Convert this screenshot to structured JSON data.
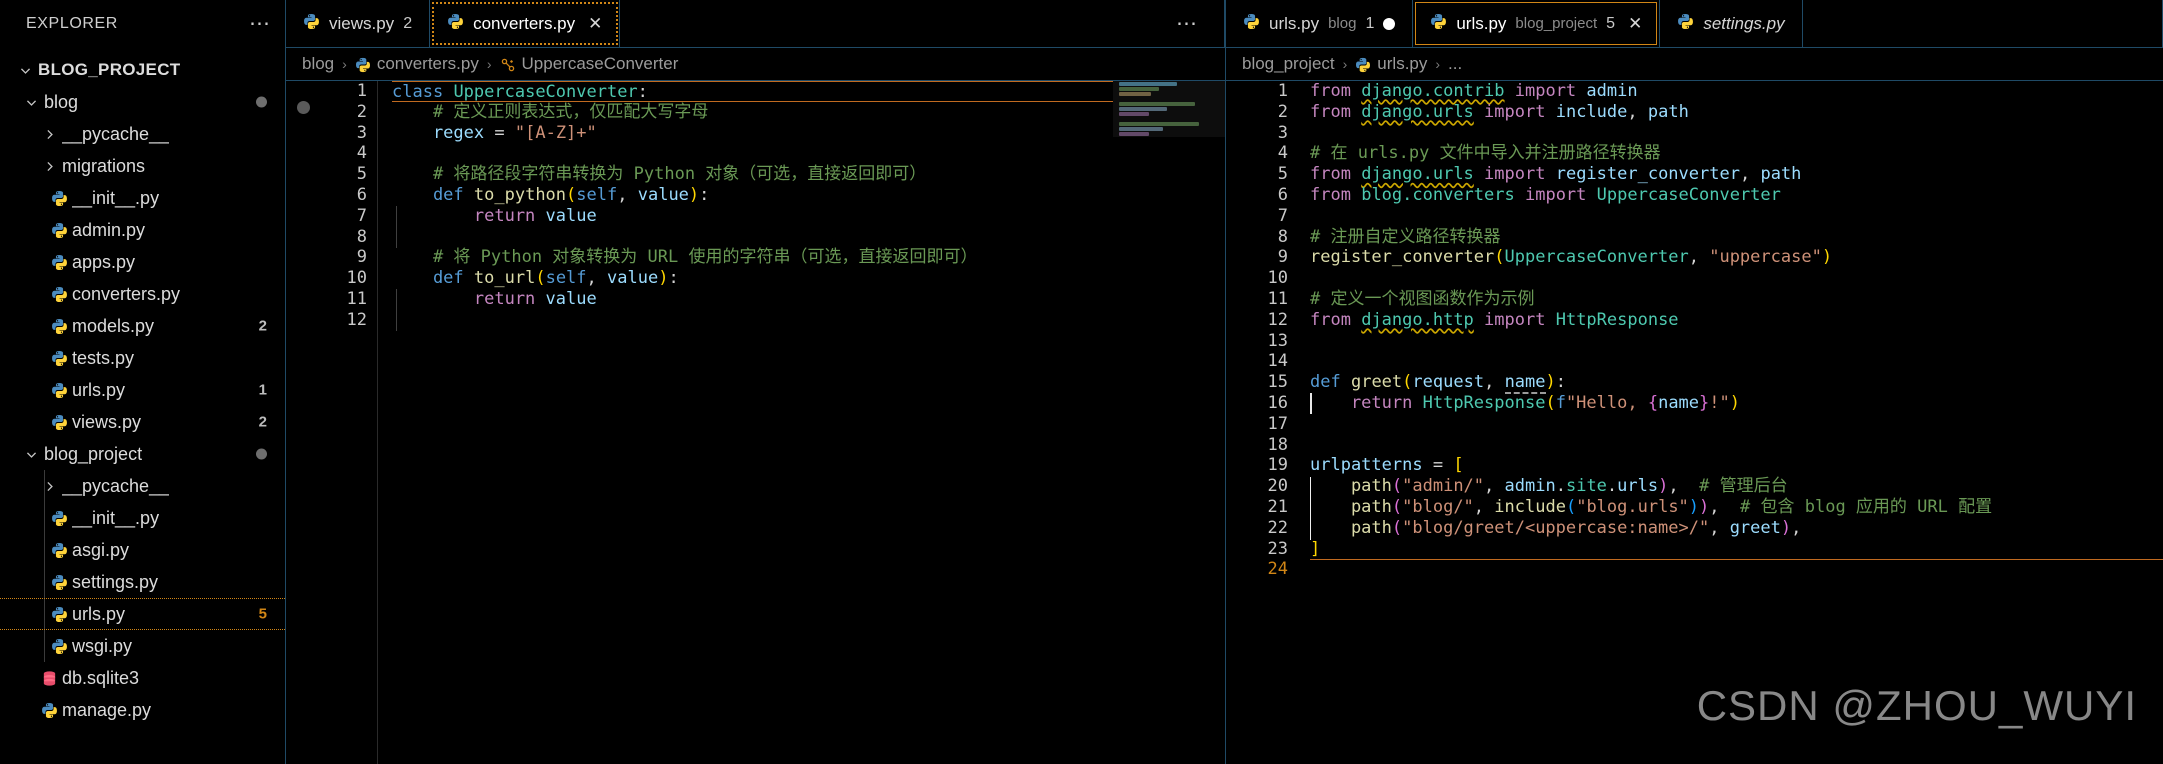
{
  "sidebar": {
    "title": "EXPLORER",
    "more_icon": "ellipsis-icon",
    "root": {
      "label": "BLOG_PROJECT",
      "expanded": true
    },
    "items": [
      {
        "label": "blog",
        "type": "folder",
        "indent": 1,
        "expanded": true,
        "badge": "",
        "dot": true
      },
      {
        "label": "__pycache__",
        "type": "folder",
        "indent": 2,
        "expanded": false,
        "badge": ""
      },
      {
        "label": "migrations",
        "type": "folder",
        "indent": 2,
        "expanded": false,
        "badge": ""
      },
      {
        "label": "__init__.py",
        "type": "python",
        "indent": 2,
        "badge": ""
      },
      {
        "label": "admin.py",
        "type": "python",
        "indent": 2,
        "badge": ""
      },
      {
        "label": "apps.py",
        "type": "python",
        "indent": 2,
        "badge": ""
      },
      {
        "label": "converters.py",
        "type": "python",
        "indent": 2,
        "badge": ""
      },
      {
        "label": "models.py",
        "type": "python",
        "indent": 2,
        "badge": "2"
      },
      {
        "label": "tests.py",
        "type": "python",
        "indent": 2,
        "badge": ""
      },
      {
        "label": "urls.py",
        "type": "python",
        "indent": 2,
        "badge": "1"
      },
      {
        "label": "views.py",
        "type": "python",
        "indent": 2,
        "badge": "2"
      },
      {
        "label": "blog_project",
        "type": "folder",
        "indent": 1,
        "expanded": true,
        "badge": "",
        "dot": true
      },
      {
        "label": "__pycache__",
        "type": "folder",
        "indent": 2,
        "expanded": false,
        "badge": ""
      },
      {
        "label": "__init__.py",
        "type": "python",
        "indent": 2,
        "badge": ""
      },
      {
        "label": "asgi.py",
        "type": "python",
        "indent": 2,
        "badge": ""
      },
      {
        "label": "settings.py",
        "type": "python",
        "indent": 2,
        "badge": ""
      },
      {
        "label": "urls.py",
        "type": "python",
        "indent": 2,
        "badge": "5",
        "selected": true
      },
      {
        "label": "wsgi.py",
        "type": "python",
        "indent": 2,
        "badge": ""
      },
      {
        "label": "db.sqlite3",
        "type": "database",
        "indent": 1,
        "badge": ""
      },
      {
        "label": "manage.py",
        "type": "python",
        "indent": 1,
        "badge": ""
      }
    ]
  },
  "left_group": {
    "more_icon": "ellipsis-icon",
    "tabs": [
      {
        "name": "views.py",
        "desc": "",
        "count": "2",
        "icon": "python-icon",
        "active": false,
        "dirty": false,
        "closeable": false
      },
      {
        "name": "converters.py",
        "desc": "",
        "count": "",
        "icon": "python-icon",
        "active": true,
        "dirty": false,
        "closeable": true,
        "close_label": "✕"
      }
    ],
    "breadcrumb": [
      {
        "label": "blog",
        "icon": ""
      },
      {
        "label": "converters.py",
        "icon": "python-icon"
      },
      {
        "label": "UppercaseConverter",
        "icon": "class-icon"
      }
    ],
    "breadcrumb_sep": "›",
    "lines": [
      "1",
      "2",
      "3",
      "4",
      "5",
      "6",
      "7",
      "8",
      "9",
      "10",
      "11",
      "12"
    ],
    "code": [
      "class UppercaseConverter:",
      "    # 定义正则表达式，仅匹配大写字母",
      "    regex = \"[A-Z]+\"",
      "",
      "    # 将路径段字符串转换为 Python 对象（可选，直接返回即可）",
      "    def to_python(self, value):",
      "        return value",
      "",
      "    # 将 Python 对象转换为 URL 使用的字符串（可选，直接返回即可）",
      "    def to_url(self, value):",
      "        return value",
      ""
    ],
    "active_line": 1
  },
  "right_group": {
    "more_icon": "ellipsis-icon",
    "tabs": [
      {
        "name": "urls.py",
        "desc": "blog",
        "count": "1",
        "icon": "python-icon",
        "active": false,
        "dirty": true,
        "closeable": false
      },
      {
        "name": "urls.py",
        "desc": "blog_project",
        "count": "5",
        "icon": "python-icon",
        "active": true,
        "dirty": false,
        "closeable": true,
        "close_label": "✕"
      },
      {
        "name": "settings.py",
        "desc": "",
        "count": "",
        "icon": "python-icon",
        "active": false,
        "dirty": false,
        "closeable": false,
        "preview": true
      }
    ],
    "breadcrumb": [
      {
        "label": "blog_project",
        "icon": ""
      },
      {
        "label": "urls.py",
        "icon": "python-icon"
      },
      {
        "label": "...",
        "icon": ""
      }
    ],
    "breadcrumb_sep": "›",
    "lines": [
      "1",
      "2",
      "3",
      "4",
      "5",
      "6",
      "7",
      "8",
      "9",
      "10",
      "11",
      "12",
      "13",
      "14",
      "15",
      "16",
      "17",
      "18",
      "19",
      "20",
      "21",
      "22",
      "23",
      "24"
    ],
    "code": [
      "from django.contrib import admin",
      "from django.urls import include, path",
      "",
      "# 在 urls.py 文件中导入并注册路径转换器",
      "from django.urls import register_converter, path",
      "from blog.converters import UppercaseConverter",
      "",
      "# 注册自定义路径转换器",
      "register_converter(UppercaseConverter, \"uppercase\")",
      "",
      "# 定义一个视图函数作为示例",
      "from django.http import HttpResponse",
      "",
      "",
      "def greet(request, name):",
      "    return HttpResponse(f\"Hello, {name}!\")",
      "",
      "",
      "urlpatterns = [",
      "    path(\"admin/\", admin.site.urls),  # 管理后台",
      "    path(\"blog/\", include(\"blog.urls\")),  # 包含 blog 应用的 URL 配置",
      "    path(\"blog/greet/<uppercase:name>/\", greet),",
      "]",
      ""
    ],
    "active_line": 24
  },
  "watermark": "CSDN @ZHOU_WUYI",
  "colors": {
    "accent": "#d18616",
    "border": "#1f4a66",
    "background": "#000000",
    "keyword": "#c586c0",
    "class": "#4ec9b0",
    "string": "#ce9178",
    "comment": "#6a9955",
    "function": "#dcdcaa",
    "variable": "#9cdcfe",
    "warning_squiggle": "#cca700"
  }
}
